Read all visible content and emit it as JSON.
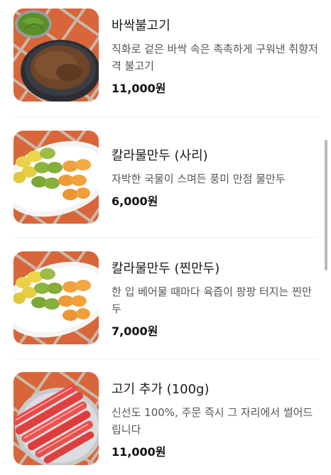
{
  "menu": {
    "items": [
      {
        "name": "바싹불고기",
        "description": "직화로 겉은 바싹 속은 촉촉하게 구워낸 취향저격 불고기",
        "price": "11,000원",
        "image": "bulgogi-photo"
      },
      {
        "name": "칼라물만두 (사리)",
        "description": "자박한 국물이 스며든 풍미 만점 물만두",
        "price": "6,000원",
        "image": "color-dumplings-photo"
      },
      {
        "name": "칼라물만두 (찐만두)",
        "description": "한 입 베어물 때마다 육즙이 팡팡 터지는 찐만두",
        "price": "7,000원",
        "image": "color-dumplings-steamed-photo"
      },
      {
        "name": "고기 추가 (100g)",
        "description": "신선도 100%, 주문 즉시 그 자리에서 썰어드립니다",
        "price": "11,000원",
        "image": "raw-beef-slices-photo"
      }
    ]
  },
  "colors": {
    "background": "#ffffff",
    "text_primary": "#1b1b1b",
    "text_secondary": "#555555",
    "divider": "#efefef",
    "scrollbar": "#b9b9b9"
  }
}
